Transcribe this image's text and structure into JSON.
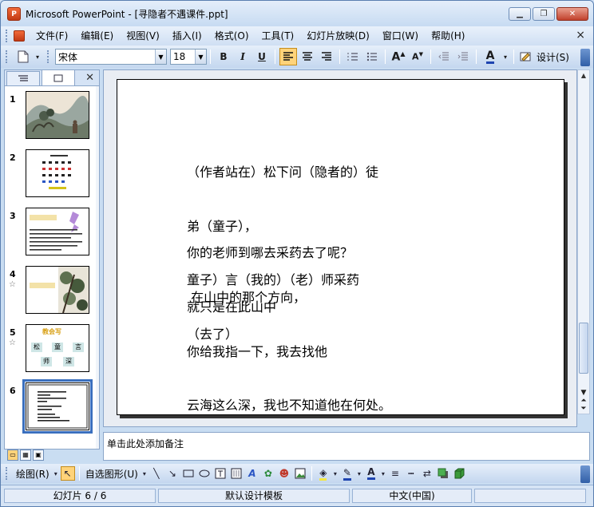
{
  "window": {
    "title": "Microsoft PowerPoint - [寻隐者不遇课件.ppt]",
    "app_icon_letter": "P"
  },
  "menu": {
    "items": [
      "文件(F)",
      "编辑(E)",
      "视图(V)",
      "插入(I)",
      "格式(O)",
      "工具(T)",
      "幻灯片放映(D)",
      "窗口(W)",
      "帮助(H)"
    ],
    "close_glyph": "×"
  },
  "toolbar": {
    "font_name": "宋体",
    "font_size": "18",
    "bold": "B",
    "italic": "I",
    "underline": "U",
    "design_label": "设计(S)"
  },
  "outline_pane": {
    "slides": [
      {
        "number": "1",
        "has_animation": false
      },
      {
        "number": "2",
        "has_animation": false
      },
      {
        "number": "3",
        "has_animation": false
      },
      {
        "number": "4",
        "has_animation": true
      },
      {
        "number": "5",
        "has_animation": true,
        "title": "教会写",
        "chars": [
          "松",
          "童",
          "言",
          "师",
          "深"
        ]
      },
      {
        "number": "6",
        "has_animation": false,
        "selected": true
      }
    ]
  },
  "slide": {
    "para1": [
      "（作者站在）松下问（隐者的）徒",
      "弟（童子），",
      "童子）言（我的）（老）师采药",
      "（去了）"
    ],
    "para2": [
      "你的老师到哪去采药去了呢？",
      "就只是在此山中"
    ],
    "para3": [
      " 在山中的那个方向，",
      "你给我指一下，我去找他",
      "云海这么深，我也不知道他在何处。"
    ]
  },
  "notes": {
    "placeholder": "单击此处添加备注"
  },
  "drawing_toolbar": {
    "draw_label": "绘图(R)",
    "autoshapes_label": "自选图形(U)"
  },
  "status": {
    "slide_indicator": "幻灯片 6 / 6",
    "template": "默认设计模板",
    "language": "中文(中国)"
  },
  "colors": {
    "accent": "#3a6fbe",
    "active_button": "#ffd37a"
  }
}
